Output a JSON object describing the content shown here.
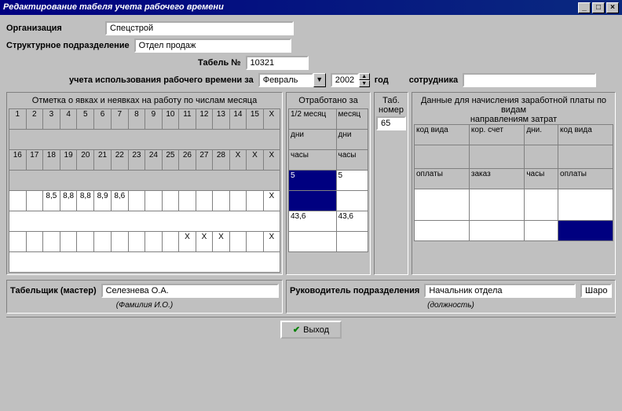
{
  "title": "Редактирование табеля учета рабочего времени",
  "labels": {
    "org": "Организация",
    "dept": "Структурное подразделение",
    "tabel_no": "Табель №",
    "period": "учета использования рабочего времени за",
    "year": "год",
    "employee": "сотрудника",
    "panel1": "Отметка о явках и неявках на работу по числам месяца",
    "panel2": "Отработано за",
    "panel3_a": "Таб.",
    "panel3_b": "номер",
    "panel4_a": "Данные для начисления заработной платы по видам",
    "panel4_b": "направлениям затрат",
    "p2_half": "1/2 месяц",
    "p2_month": "месяц",
    "p2_days": "дни",
    "p2_hours": "часы",
    "p4_kod": "код вида",
    "p4_kor": "кор. счет",
    "p4_dni": "дни.",
    "p4_opl": "оплаты",
    "p4_zak": "заказ",
    "p4_chasy": "часы",
    "timekeeper": "Табельщик (мастер)",
    "fio": "(Фамилия И.О.)",
    "supervisor": "Руководитель подразделения",
    "position": "(должность)",
    "exit": "Выход"
  },
  "values": {
    "org": "Спецстрой",
    "dept": "Отдел продаж",
    "tabel_no": "10321",
    "month": "Февраль",
    "year": "2002",
    "employee": "",
    "tab_nomer": "65",
    "timekeeper": "Селезнева О.А.",
    "supervisor": "Начальник отдела",
    "sharo": "Шаро"
  },
  "days_row1": [
    "1",
    "2",
    "3",
    "4",
    "5",
    "6",
    "7",
    "8",
    "9",
    "10",
    "11",
    "12",
    "13",
    "14",
    "15",
    "X"
  ],
  "days_row2": [
    "16",
    "17",
    "18",
    "19",
    "20",
    "21",
    "22",
    "23",
    "24",
    "25",
    "26",
    "27",
    "28",
    "X",
    "X",
    "X"
  ],
  "data_row1": [
    "",
    "",
    "8,5",
    "8,8",
    "8,8",
    "8,9",
    "8,6",
    "",
    "",
    "",
    "",
    "",
    "",
    "",
    "",
    "X"
  ],
  "data_row2": [
    "",
    "",
    "",
    "",
    "",
    "",
    "",
    "",
    "",
    "",
    "X",
    "X",
    "X",
    "",
    "",
    "X"
  ],
  "p2_vals": {
    "r1a": "5",
    "r1b": "5",
    "r2a": "43,6",
    "r2b": "43,6"
  }
}
